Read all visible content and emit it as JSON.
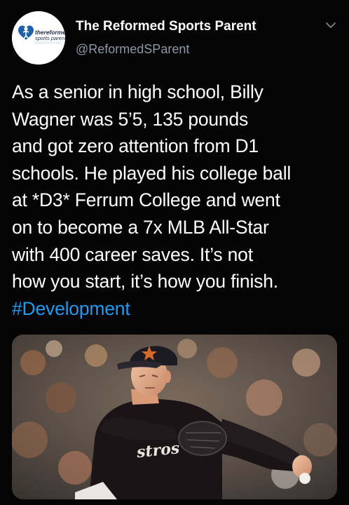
{
  "author": {
    "display_name": "The Reformed Sports Parent",
    "handle": "@ReformedSParent",
    "avatar_text_line1": "thereformed",
    "avatar_text_line2": "sports parent"
  },
  "tweet": {
    "lines": [
      "As a senior in high school, Billy",
      "Wagner was 5’5, 135 pounds",
      "and got zero attention from D1",
      "schools. He played his college ball",
      "at *D3* Ferrum College and went",
      "on to become a 7x MLB All-Star",
      "with 400 career saves. It’s not",
      "how you start, it’s how you finish."
    ],
    "hashtag": "#Development"
  },
  "media": {
    "jersey_text": "stros"
  },
  "icons": {
    "more": "chevron-down-icon",
    "avatar_logo": "heart-figure-logo"
  },
  "colors": {
    "background": "#050505",
    "text": "#ffffff",
    "secondary_text": "#8b98a5",
    "hashtag": "#1d9bf0",
    "avatar_blue": "#1e5fa8"
  }
}
